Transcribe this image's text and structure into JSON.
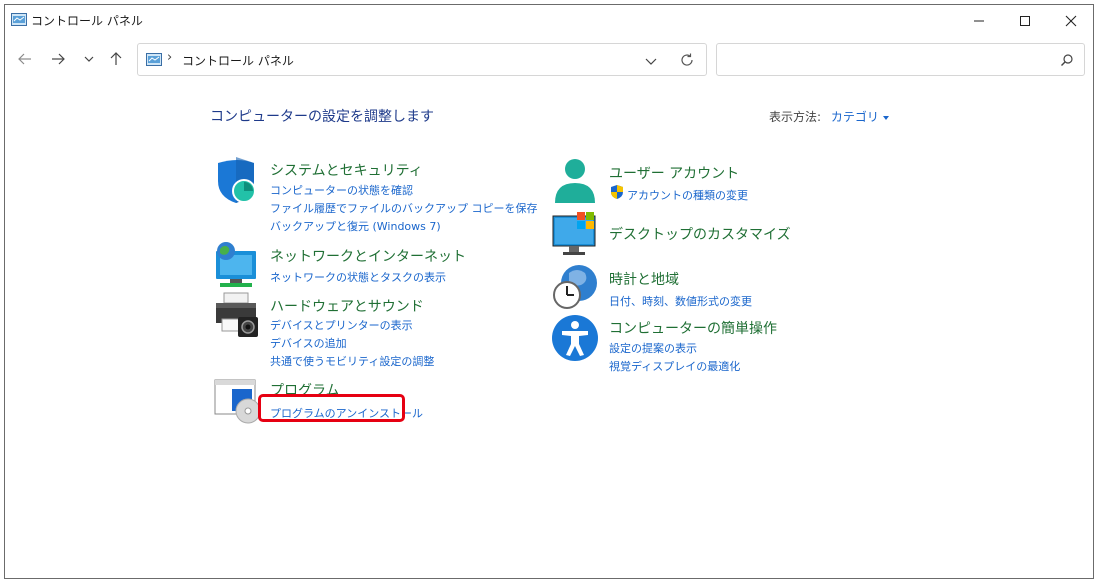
{
  "window": {
    "title": "コントロール パネル"
  },
  "addressbar": {
    "path": "コントロール パネル",
    "separator": "›"
  },
  "search": {
    "placeholder": ""
  },
  "content": {
    "heading": "コンピューターの設定を調整します",
    "viewby_label": "表示方法:",
    "viewby_value": "カテゴリ"
  },
  "left_categories": [
    {
      "title": "システムとセキュリティ",
      "links": [
        "コンピューターの状態を確認",
        "ファイル履歴でファイルのバックアップ コピーを保存",
        "バックアップと復元 (Windows 7)"
      ]
    },
    {
      "title": "ネットワークとインターネット",
      "links": [
        "ネットワークの状態とタスクの表示"
      ]
    },
    {
      "title": "ハードウェアとサウンド",
      "links": [
        "デバイスとプリンターの表示",
        "デバイスの追加",
        "共通で使うモビリティ設定の調整"
      ]
    },
    {
      "title": "プログラム",
      "links": [
        "プログラムのアンインストール"
      ]
    }
  ],
  "right_categories": [
    {
      "title": "ユーザー アカウント",
      "links": [
        "アカウントの種類の変更"
      ]
    },
    {
      "title": "デスクトップのカスタマイズ",
      "links": []
    },
    {
      "title": "時計と地域",
      "links": [
        "日付、時刻、数値形式の変更"
      ]
    },
    {
      "title": "コンピューターの簡単操作",
      "links": [
        "設定の提案の表示",
        "視覚ディスプレイの最適化"
      ]
    }
  ],
  "colors": {
    "category_title": "#1f6f34",
    "link": "#1a66cc",
    "heading": "#1e3a8a",
    "highlight_box": "#e60012"
  },
  "icons": {
    "system_security": "shield-icon",
    "network": "network-globe-icon",
    "hardware": "printer-icon",
    "programs": "programs-disc-icon",
    "user_accounts": "user-icon",
    "desktop": "desktop-monitor-icon",
    "clock_region": "clock-globe-icon",
    "ease_of_access": "accessibility-icon"
  }
}
